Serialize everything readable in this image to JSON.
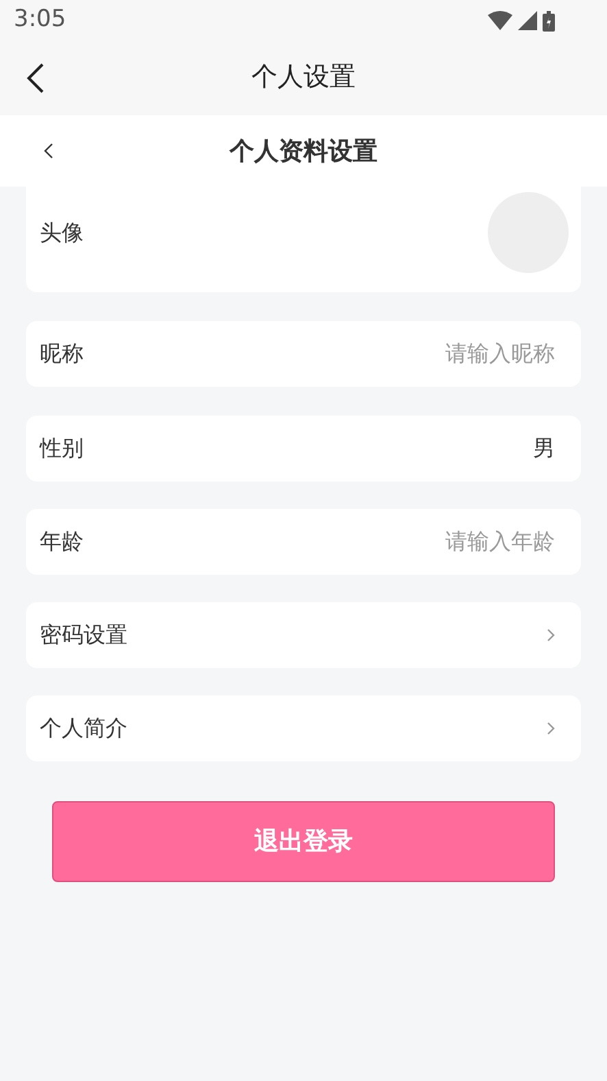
{
  "status_bar": {
    "time": "3:05"
  },
  "app_bar": {
    "title": "个人设置"
  },
  "header": {
    "title": "个人资料设置"
  },
  "rows": [
    {
      "kind": "avatar",
      "label": "头像"
    },
    {
      "kind": "input",
      "label": "昵称",
      "placeholder": "请输入昵称"
    },
    {
      "kind": "value",
      "label": "性别",
      "value": "男"
    },
    {
      "kind": "input",
      "label": "年龄",
      "placeholder": "请输入年龄"
    },
    {
      "kind": "link",
      "label": "密码设置"
    },
    {
      "kind": "link",
      "label": "个人简介"
    }
  ],
  "logout_button": "退出登录"
}
